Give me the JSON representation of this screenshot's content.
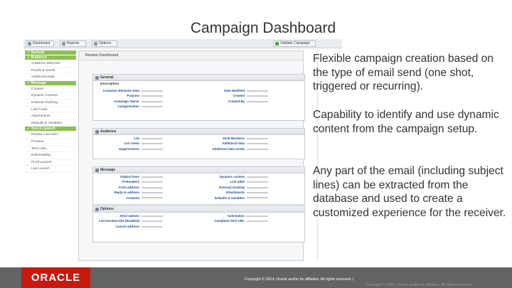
{
  "slide": {
    "title": "Campaign Dashboard",
    "bullets": [
      "Flexible campaign creation based on the type of email send (one shot, triggered or recurring).",
      "Capability to identify and use dynamic content from the campaign setup.",
      "Any part of the email (including subject lines) can be extracted from the database and used to create a customized experience for the receiver."
    ]
  },
  "app": {
    "toolbar": {
      "dashboard": "Dashboard",
      "reports": "Reports",
      "options": "Options",
      "validate": "Validate Campaign"
    },
    "nav": [
      {
        "section": "✓ General",
        "items": []
      },
      {
        "section": "✓ Audience",
        "items": [
          "Audience Selection",
          "Proofs & Seeds",
          "Additional Data"
        ]
      },
      {
        "section": "✓ Message",
        "items": [
          "Content",
          "Dynamic Content",
          "External Tracking",
          "Link Fonts",
          "Attachments",
          "Defaults & Variables"
        ]
      },
      {
        "section": "✓ Test & Launch",
        "items": [
          "Review Last Alert",
          "Preview",
          "Test Links",
          "Deliverability",
          "Proof Launch",
          "Live Launch"
        ]
      }
    ],
    "content_title": "Review Dashboard",
    "panels": [
      {
        "title": "General",
        "subtitle": "Description",
        "left": [
          "Customer Behavior Data",
          "Purpose",
          "Campaign Owner",
          "Categorization"
        ],
        "right": [
          "Date Modified",
          "Created",
          "Created By"
        ]
      },
      {
        "title": "Audience",
        "subtitle": "",
        "left": [
          "List",
          "List Views",
          "Suppressions"
        ],
        "right": [
          "Seed Members",
          "Additional data",
          "Additional data sends"
        ]
      },
      {
        "title": "Message",
        "subtitle": "",
        "left": [
          "Subject lines",
          "Preheaders",
          "From address",
          "Reply-to address",
          "Contents"
        ],
        "right": [
          "Dynamic content",
          "Link table",
          "External tracking",
          "Attachments",
          "Defaults & Variables"
        ]
      },
      {
        "title": "Options",
        "subtitle": "",
        "left": [
          "Send options",
          "List Unsubscribe (Enabled)",
          "Launch address"
        ],
        "right": [
          "Automation",
          "Complaint Alert URL"
        ]
      }
    ]
  },
  "footer": {
    "logo": "ORACLE",
    "copyright": "Copyright © 2014, Oracle and/or its affiliates. All rights reserved. |",
    "copyright_faint": "Copyright © 2014, Oracle and/or its affiliates. All rights reserved."
  }
}
